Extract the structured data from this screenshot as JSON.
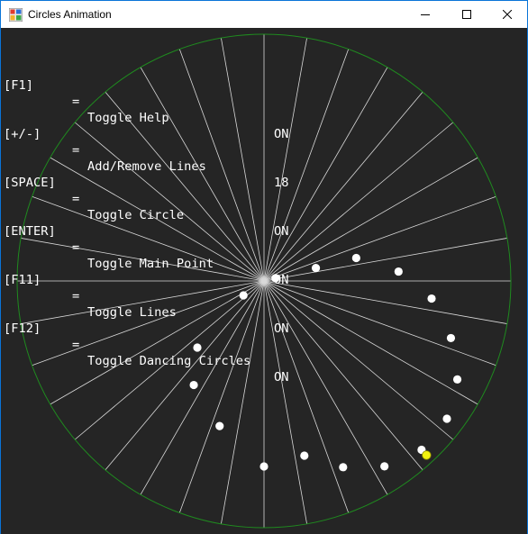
{
  "window": {
    "title": "Circles Animation",
    "app_icon": "windows-form-app-icon",
    "controls": {
      "minimize_icon": "minimize-icon",
      "maximize_icon": "maximize-icon",
      "close_icon": "close-icon"
    }
  },
  "help": {
    "rows": [
      {
        "key": "[F1]",
        "eq": "=",
        "action": "Toggle Help",
        "state": "ON"
      },
      {
        "key": "[+/-]",
        "eq": "=",
        "action": "Add/Remove Lines",
        "state": "18"
      },
      {
        "key": "[SPACE]",
        "eq": "=",
        "action": "Toggle Circle",
        "state": "ON"
      },
      {
        "key": "[ENTER]",
        "eq": "=",
        "action": "Toggle Main Point",
        "state": "ON"
      },
      {
        "key": "[F11]",
        "eq": "=",
        "action": "Toggle Lines",
        "state": "ON"
      },
      {
        "key": "[F12]",
        "eq": "=",
        "action": "Toggle Dancing Circles",
        "state": "ON"
      }
    ]
  },
  "scene": {
    "line_count": 18,
    "colors": {
      "background": "#252525",
      "circle": "#1f8a1f",
      "lines": "#d9d9d9",
      "dots": "#ffffff",
      "main_point": "#f2f20f",
      "main_point_outline": "#8a8a00"
    },
    "dots": [
      {
        "angle": -14,
        "r": 0.0478
      },
      {
        "angle": -14,
        "r": 0.2165
      },
      {
        "angle": -14,
        "r": 0.385
      },
      {
        "angle": -4,
        "r": 0.5463
      },
      {
        "angle": 6,
        "r": 0.6826
      },
      {
        "angle": 17,
        "r": 0.7917
      },
      {
        "angle": 27,
        "r": 0.8788
      },
      {
        "angle": 37,
        "r": 0.9277
      },
      {
        "angle": 47,
        "r": 0.9358
      },
      {
        "angle": 57,
        "r": 0.8958
      },
      {
        "angle": 67,
        "r": 0.82
      },
      {
        "angle": 77,
        "r": 0.7267
      },
      {
        "angle": 90,
        "r": 0.7517
      },
      {
        "angle": 107,
        "r": 0.6149
      },
      {
        "angle": 124,
        "r": 0.5087
      },
      {
        "angle": 135,
        "r": 0.3819
      },
      {
        "angle": 145,
        "r": 0.1016
      }
    ],
    "main_point": {
      "angle": 47,
      "r": 0.9653
    }
  }
}
